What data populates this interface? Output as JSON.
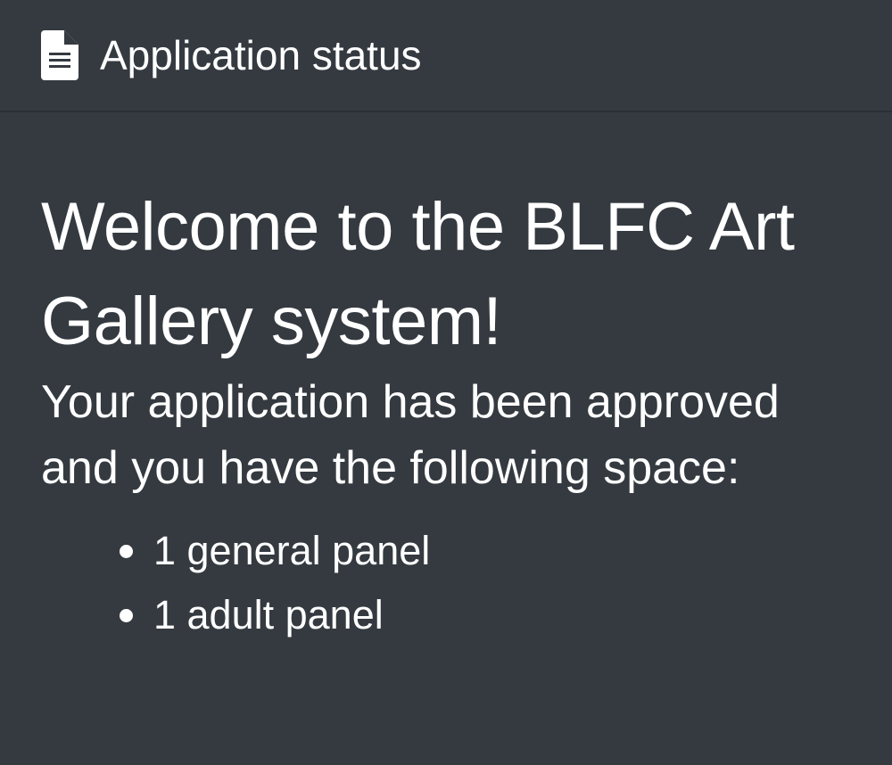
{
  "header": {
    "icon": "file-text-icon",
    "title": "Application status"
  },
  "main": {
    "heading": "Welcome to the BLFC Art Gallery system!",
    "status_text": "Your application has been approved and you have the following space:",
    "spaces": [
      "1 general panel",
      "1 adult panel"
    ]
  },
  "colors": {
    "background": "#343a40",
    "text": "#ffffff",
    "divider": "#2a2f34"
  }
}
